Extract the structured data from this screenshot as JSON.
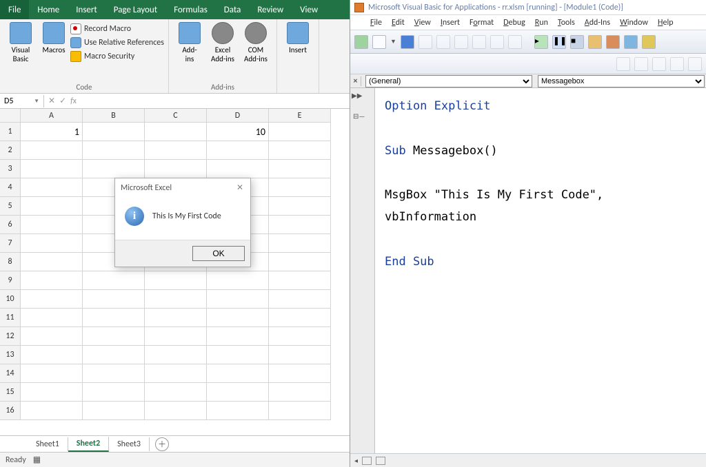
{
  "excel": {
    "tabs": [
      "File",
      "Home",
      "Insert",
      "Page Layout",
      "Formulas",
      "Data",
      "Review",
      "View"
    ],
    "ribbon": {
      "code_group": {
        "label": "Code",
        "visual_basic": "Visual\nBasic",
        "macros": "Macros",
        "record": "Record Macro",
        "relative": "Use Relative References",
        "security": "Macro Security"
      },
      "addins_group": {
        "label": "Add-ins",
        "addins": "Add-\nins",
        "excel_addins": "Excel\nAdd-ins",
        "com_addins": "COM\nAdd-ins"
      },
      "controls_group": {
        "insert": "Insert"
      }
    },
    "name_box": "D5",
    "formula": "",
    "columns": [
      "A",
      "B",
      "C",
      "D",
      "E"
    ],
    "rows": [
      "1",
      "2",
      "3",
      "4",
      "5",
      "6",
      "7",
      "8",
      "9",
      "10",
      "11",
      "12",
      "13",
      "14",
      "15",
      "16"
    ],
    "cells": {
      "A1": "1",
      "D1": "10"
    },
    "sheets": [
      "Sheet1",
      "Sheet2",
      "Sheet3"
    ],
    "active_sheet": "Sheet2",
    "status": "Ready"
  },
  "msgbox": {
    "title": "Microsoft Excel",
    "text": "This Is My First Code",
    "ok": "OK"
  },
  "vba": {
    "title": "Microsoft Visual Basic for Applications - rr.xlsm [running] - [Module1 (Code)]",
    "menu": [
      "File",
      "Edit",
      "View",
      "Insert",
      "Format",
      "Debug",
      "Run",
      "Tools",
      "Add-Ins",
      "Window",
      "Help"
    ],
    "general": "(General)",
    "proc": "Messagebox",
    "code_line1a": "Option Explicit",
    "code_line2a": "Sub",
    "code_line2b": " Messagebox()",
    "code_line3": "MsgBox \"This Is My First Code\", vbInformation",
    "code_line4": "End Sub"
  }
}
